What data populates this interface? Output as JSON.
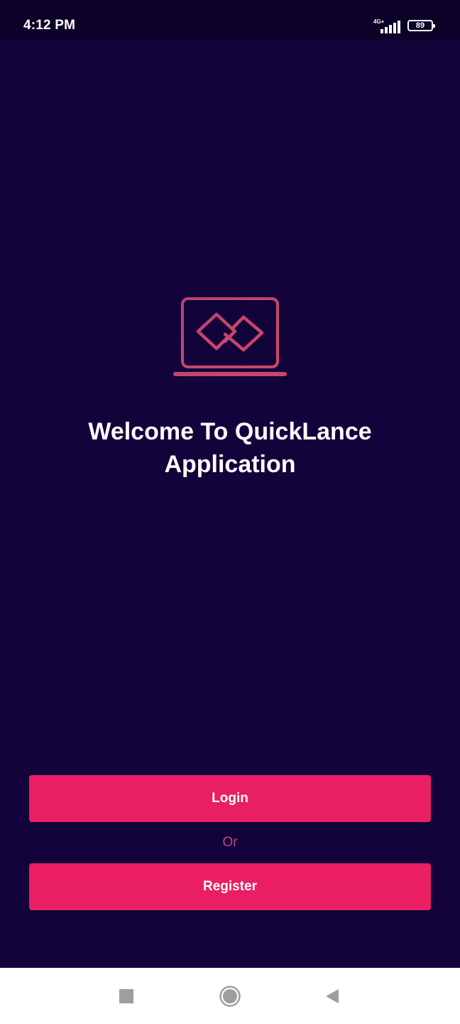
{
  "status_bar": {
    "time": "4:12 PM",
    "network": "4G+",
    "battery": "89"
  },
  "logo": {
    "icon": "laptop-link-icon",
    "color": "#c2456e"
  },
  "welcome": {
    "title": "Welcome To QuickLance Application"
  },
  "actions": {
    "login_label": "Login",
    "or_label": "Or",
    "register_label": "Register"
  },
  "nav_bar": {
    "recents_icon": "square-icon",
    "home_icon": "circle-icon",
    "back_icon": "triangle-back-icon"
  },
  "colors": {
    "background": "#12033b",
    "accent": "#e91e63",
    "or_text": "#c2487f"
  }
}
